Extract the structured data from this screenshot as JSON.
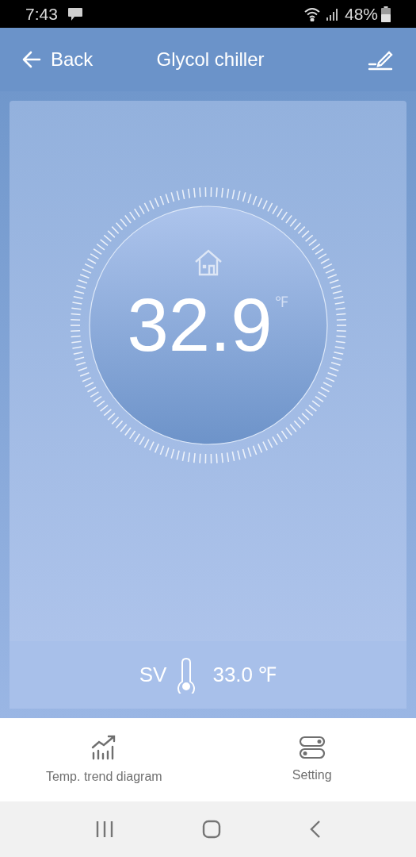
{
  "status_bar": {
    "time": "7:43",
    "battery": "48%"
  },
  "header": {
    "back": "Back",
    "title": "Glycol chiller"
  },
  "dial": {
    "value": "32.9",
    "unit": "℉"
  },
  "setpoint": {
    "label": "SV",
    "value": "33.0 ℉"
  },
  "bottom_tabs": [
    {
      "label": "Temp. trend diagram",
      "kind": "trend"
    },
    {
      "label": "Setting",
      "kind": "setting"
    }
  ]
}
